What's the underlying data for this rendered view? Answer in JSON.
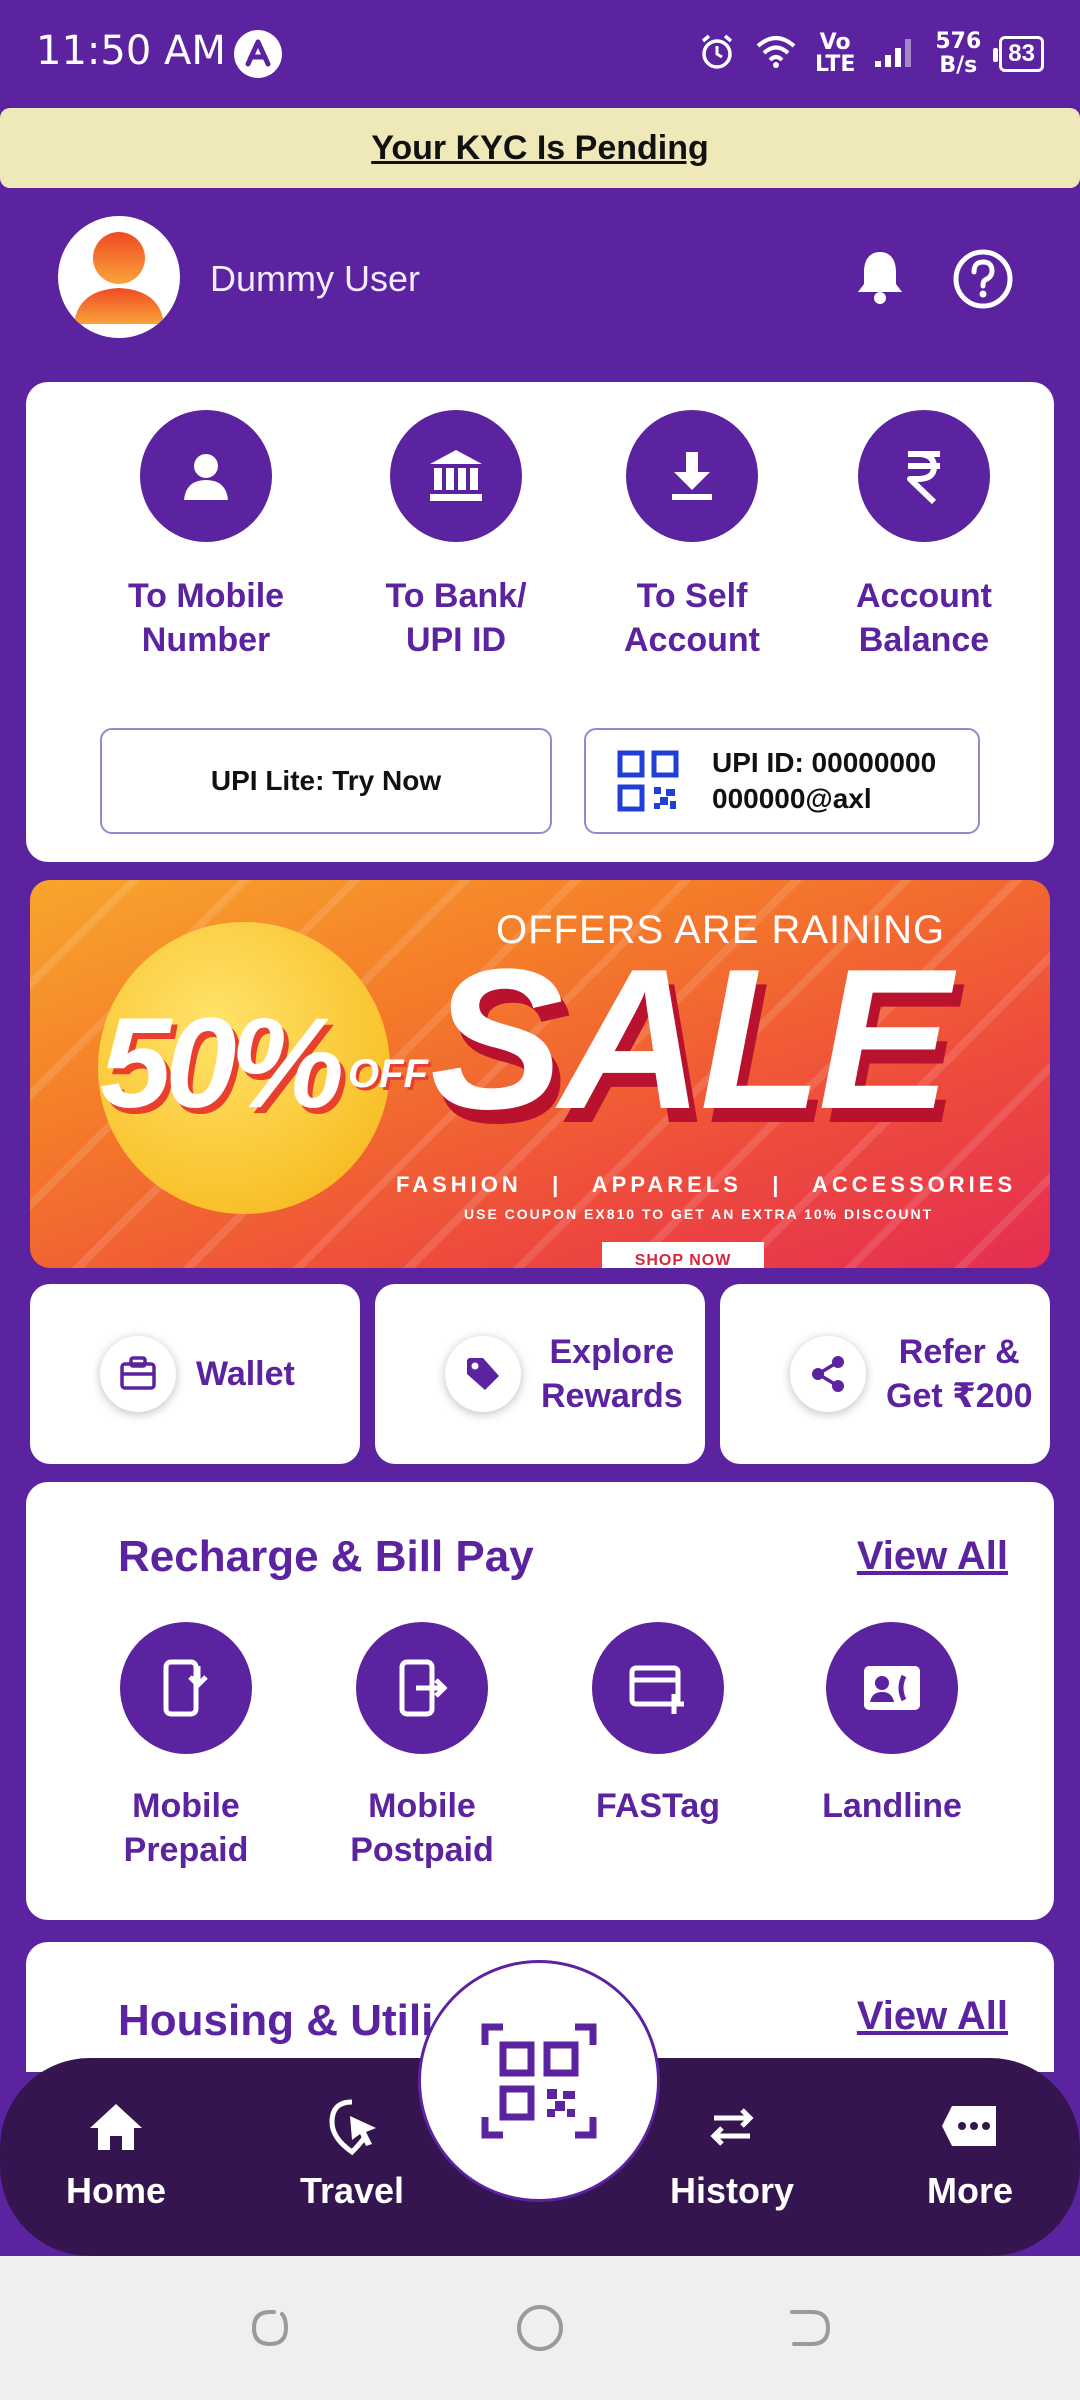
{
  "status_bar": {
    "time": "11:50 AM",
    "volte_line1": "Vo",
    "volte_line2": "LTE",
    "net_speed_value": "576",
    "net_speed_unit": "B/s",
    "battery": "83",
    "icons": [
      "app-a-icon",
      "alarm-icon",
      "wifi-icon",
      "signal-icon",
      "battery-icon"
    ]
  },
  "kyc_banner": {
    "text": "Your KYC Is Pending"
  },
  "header": {
    "user_name": "Dummy User",
    "icons": [
      "avatar",
      "bell-icon",
      "help-icon"
    ]
  },
  "transfer": {
    "tiles": [
      {
        "line1": "To Mobile",
        "line2": "Number",
        "icon": "person-icon"
      },
      {
        "line1": "To Bank/",
        "line2": "UPI ID",
        "icon": "bank-icon"
      },
      {
        "line1": "To Self",
        "line2": "Account",
        "icon": "download-icon"
      },
      {
        "line1": "Account",
        "line2": "Balance",
        "icon": "rupee-icon"
      }
    ],
    "upi_lite": "UPI Lite: Try Now",
    "upi_id_line1": "UPI ID: 00000000",
    "upi_id_line2": "000000@axl"
  },
  "sale_banner": {
    "percent": "50%",
    "off": "OFF",
    "headline": "OFFERS ARE RAINING",
    "big_text": "SALE",
    "categories": "FASHION   |   APPARELS   |   ACCESSORIES",
    "coupon_text": "USE COUPON EX810 TO GET AN EXTRA 10% DISCOUNT",
    "cta": "SHOP NOW"
  },
  "quick_actions": [
    {
      "line1": "Wallet",
      "line2": "",
      "icon": "wallet-icon"
    },
    {
      "line1": "Explore",
      "line2": "Rewards",
      "icon": "tag-icon"
    },
    {
      "line1": "Refer &",
      "line2": "Get ₹200",
      "icon": "share-icon"
    }
  ],
  "recharge": {
    "title": "Recharge & Bill Pay",
    "view_all": "View All",
    "tiles": [
      {
        "line1": "Mobile",
        "line2": "Prepaid",
        "icon": "mobile-prepaid-icon"
      },
      {
        "line1": "Mobile",
        "line2": "Postpaid",
        "icon": "mobile-postpaid-icon"
      },
      {
        "line1": "FASTag",
        "line2": "",
        "icon": "fastag-icon"
      },
      {
        "line1": "Landline",
        "line2": "",
        "icon": "landline-icon"
      }
    ]
  },
  "housing": {
    "title": "Housing & Utili",
    "view_all": "View All"
  },
  "bottom_nav": {
    "items": [
      {
        "label": "Home",
        "icon": "home-icon"
      },
      {
        "label": "Travel",
        "icon": "travel-icon"
      },
      {
        "label": "History",
        "icon": "history-icon"
      },
      {
        "label": "More",
        "icon": "more-icon"
      }
    ],
    "scan_icon": "qr-scan-icon"
  },
  "colors": {
    "brand_purple": "#5b23a0",
    "nav_dark": "#34154f",
    "kyc_bg": "#efe8b9"
  }
}
